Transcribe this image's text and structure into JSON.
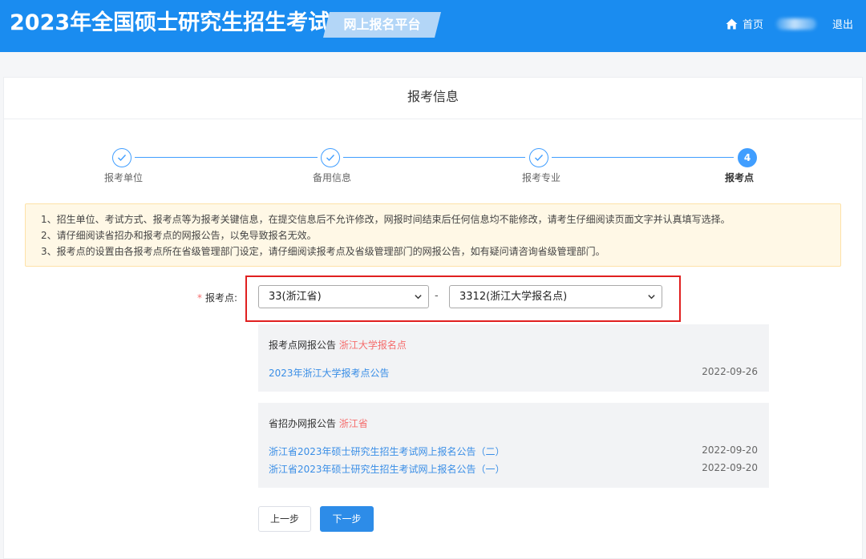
{
  "header": {
    "site_title": "2023年全国硕士研究生招生考试",
    "platform_label": "网上报名平台",
    "home_label": "首页",
    "logout_label": "退出"
  },
  "card": {
    "title": "报考信息"
  },
  "steps": [
    {
      "label": "报考单位",
      "state": "done"
    },
    {
      "label": "备用信息",
      "state": "done"
    },
    {
      "label": "报考专业",
      "state": "done"
    },
    {
      "label": "报考点",
      "state": "current",
      "number": "4"
    }
  ],
  "notice": {
    "lines": [
      "1、招生单位、考试方式、报考点等为报考关键信息，在提交信息后不允许修改，网报时间结束后任何信息均不能修改，请考生仔细阅读页面文字并认真填写选择。",
      "2、请仔细阅读省招办和报考点的网报公告，以免导致报名无效。",
      "3、报考点的设置由各报考点所在省级管理部门设定，请仔细阅读报考点及省级管理部门的网报公告，如有疑问请咨询省级管理部门。"
    ]
  },
  "form": {
    "required_mark": "*",
    "label": "报考点:",
    "province_value": "33(浙江省)",
    "separator": "-",
    "site_value": "3312(浙江大学报名点)"
  },
  "site_announcement": {
    "heading": "报考点网报公告",
    "heading_highlight": "浙江大学报名点",
    "items": [
      {
        "title": "2023年浙江大学报考点公告",
        "date": "2022-09-26"
      }
    ]
  },
  "province_announcement": {
    "heading": "省招办网报公告",
    "heading_highlight": "浙江省",
    "items": [
      {
        "title": "浙江省2023年硕士研究生招生考试网上报名公告（二）",
        "date": "2022-09-20"
      },
      {
        "title": "浙江省2023年硕士研究生招生考试网上报名公告（一）",
        "date": "2022-09-20"
      }
    ]
  },
  "buttons": {
    "prev_label": "上一步",
    "next_label": "下一步"
  },
  "colors": {
    "header_bg": "#1a8cf0",
    "accent": "#409eff",
    "highlight_red": "#e02020",
    "notice_bg": "#fff8e6"
  }
}
